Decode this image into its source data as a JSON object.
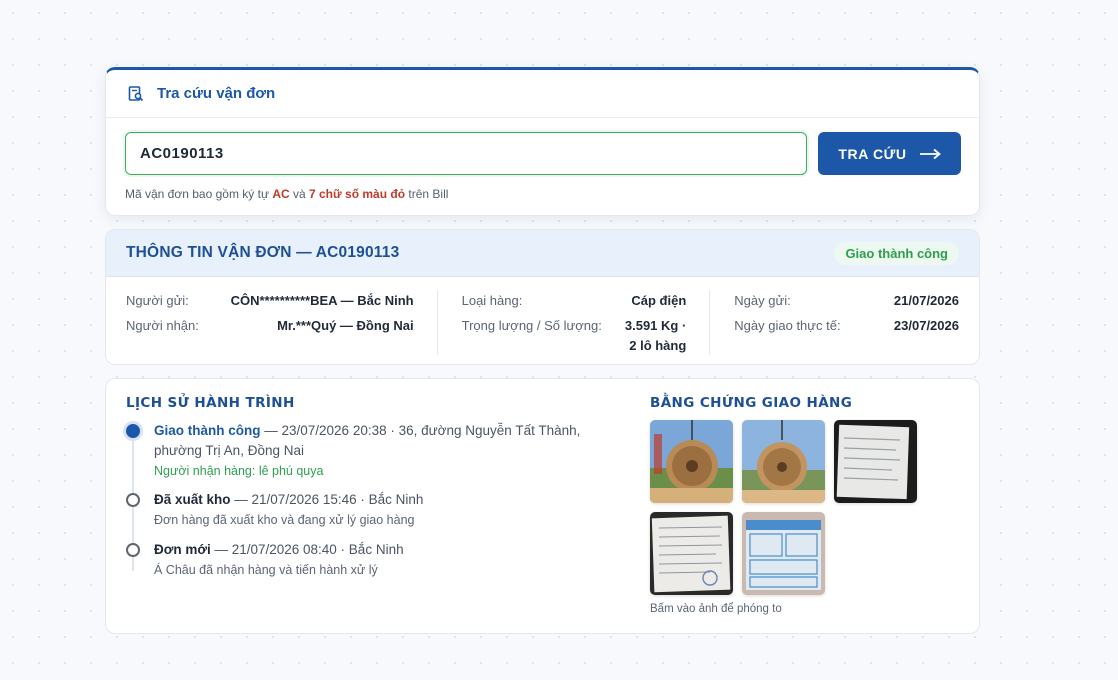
{
  "search": {
    "title": "Tra cứu vận đơn",
    "value": "AC0190113",
    "button_label": "TRA CỨU",
    "hint": {
      "part1": "Mã vận đơn bao gồm ký tự ",
      "code": "AC",
      "part2": " và ",
      "digits": "7 chữ số màu đỏ",
      "part3": " trên Bill"
    }
  },
  "shipment": {
    "title": "THÔNG TIN VẬN ĐƠN — AC0190113",
    "status": "Giao thành công",
    "sender_label": "Người gửi:",
    "sender_value": "CÔN**********BEA — Bắc Ninh",
    "receiver_label": "Người nhận:",
    "receiver_value": "Mr.***Quý — Đồng Nai",
    "goods_label": "Loại hàng:",
    "goods_value": "Cáp điện",
    "weight_label": "Trọng lượng / Số lượng:",
    "weight_value_line1": "3.591 Kg ·",
    "weight_value_line2": "2 lô hàng",
    "sent_date_label": "Ngày gửi:",
    "sent_date_value": "21/07/2026",
    "delivered_label": "Ngày giao thực tế:",
    "delivered_value": "23/07/2026"
  },
  "history": {
    "title": "LỊCH SỬ HÀNH TRÌNH",
    "events": [
      {
        "status": "Giao thành công",
        "detail": " — 23/07/2026 20:38 · 36, đường Nguyễn Tất Thành, phường Trị An, Đồng Nai",
        "sub": "Người nhận hàng: lê phú quya"
      },
      {
        "status": "Đã xuất kho",
        "detail": " — 21/07/2026 15:46 · Bắc Ninh",
        "sub": "Đơn hàng đã xuất kho và đang xử lý giao hàng"
      },
      {
        "status": "Đơn mới",
        "detail": " — 21/07/2026 08:40 · Bắc Ninh",
        "sub": "Á Châu đã nhận hàng và tiến hành xử lý"
      }
    ]
  },
  "proof": {
    "title": "BẰNG CHỨNG GIAO HÀNG",
    "hint": "Bấm vào ảnh để phóng to",
    "photos": [
      "cable-drum-photo",
      "cable-drum-photo",
      "document-photo",
      "document-photo",
      "delivery-bill-photo"
    ]
  },
  "colors": {
    "primary": "#1d58a8",
    "success": "#2e9e4f",
    "accent_red": "#c0392b"
  }
}
